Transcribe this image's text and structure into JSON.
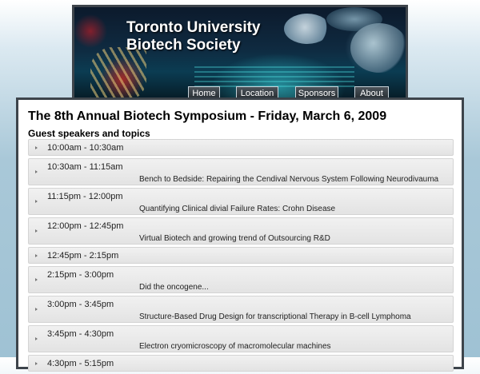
{
  "site": {
    "title_line1": "Toronto University",
    "title_line2": "Biotech Society"
  },
  "nav": {
    "items": [
      {
        "label": "Home"
      },
      {
        "label": "Location"
      },
      {
        "label": "Sponsors"
      },
      {
        "label": "About"
      }
    ]
  },
  "main": {
    "heading": "The 8th Annual Biotech Symposium - Friday, March 6, 2009",
    "subheading": "Guest speakers and topics",
    "schedule": [
      {
        "time": "10:00am - 10:30am",
        "topic": ""
      },
      {
        "time": "10:30am - 11:15am",
        "topic": "Bench to Bedside: Repairing the Cendival Nervous System Following Neurodivauma"
      },
      {
        "time": "11:15pm - 12:00pm",
        "topic": "Quantifying Clinical divial Failure Rates: Crohn Disease"
      },
      {
        "time": "12:00pm - 12:45pm",
        "topic": "Virtual Biotech and growing trend of Outsourcing R&D"
      },
      {
        "time": "12:45pm - 2:15pm",
        "topic": ""
      },
      {
        "time": "2:15pm - 3:00pm",
        "topic": "Did the oncogene..."
      },
      {
        "time": "3:00pm - 3:45pm",
        "topic": "Structure-Based Drug Design for transcriptional Therapy in B-cell Lymphoma"
      },
      {
        "time": "3:45pm - 4:30pm",
        "topic": "Electron cryomicroscopy of macromolecular machines"
      },
      {
        "time": "4:30pm - 5:15pm",
        "topic": ""
      }
    ]
  }
}
